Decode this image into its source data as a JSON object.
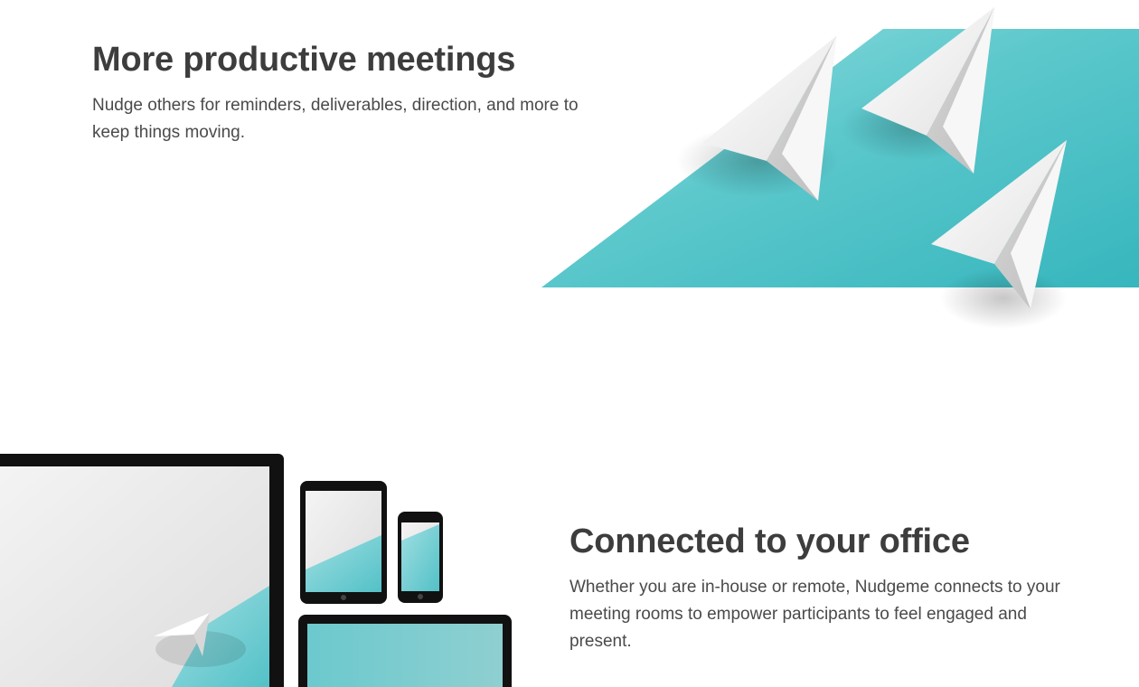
{
  "meetings": {
    "title": "More productive meetings",
    "description": "Nudge others for reminders, deliverables, direction, and more to keep things moving.",
    "illustration": "paper-planes-over-teal-band"
  },
  "office": {
    "title": "Connected to your office",
    "description": "Whether you are in-house or remote, Nudgeme connects to your meeting rooms to empower participants to feel engaged and present.",
    "illustration": "connected-devices"
  },
  "colors": {
    "teal_light": "#8fdcdf",
    "teal": "#3fbcc3",
    "heading": "#3d3d3d",
    "body_text": "#4a4a4a",
    "device_frame": "#111111",
    "plane_white": "#f4f4f4"
  }
}
